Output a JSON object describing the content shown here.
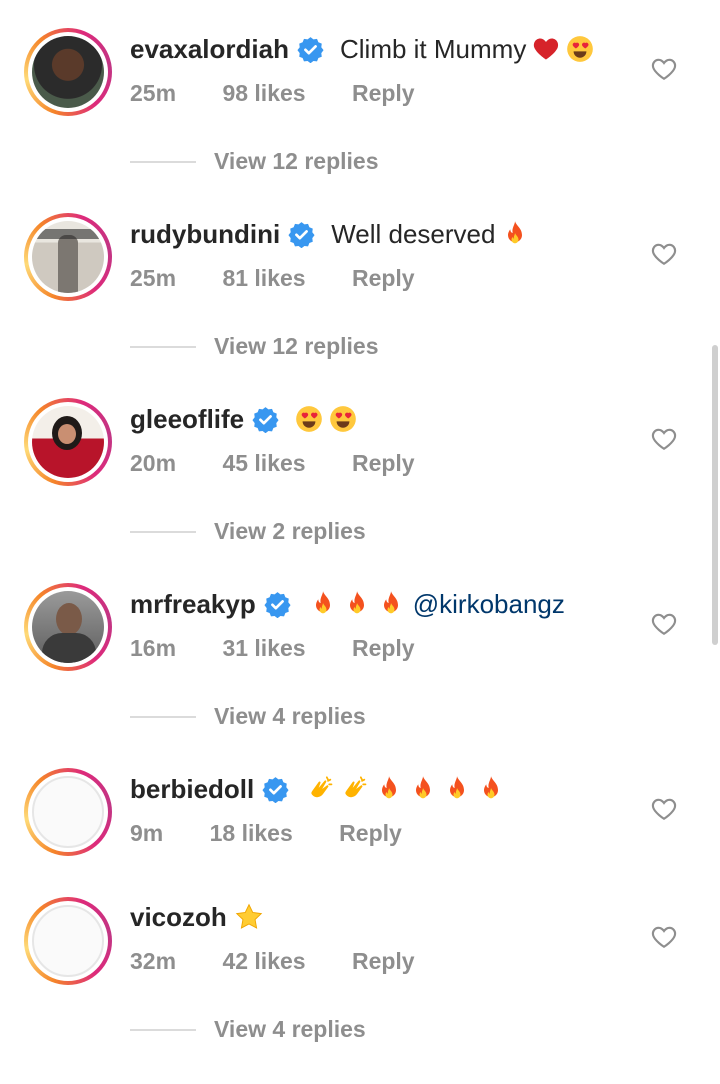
{
  "comments": [
    {
      "username": "evaxalordiah",
      "verified": true,
      "text": "Climb it Mummy",
      "emojis": [
        "red-heart",
        "heart-eyes"
      ],
      "mention": "",
      "time": "25m",
      "likes": "98 likes",
      "reply": "Reply",
      "view_replies": "View 12 replies",
      "avatar": "photo-dark"
    },
    {
      "username": "rudybundini",
      "verified": true,
      "text": "Well deserved",
      "emojis": [
        "fire"
      ],
      "mention": "",
      "time": "25m",
      "likes": "81 likes",
      "reply": "Reply",
      "view_replies": "View 12 replies",
      "avatar": "photo-magazine"
    },
    {
      "username": "gleeoflife",
      "verified": true,
      "text": "",
      "emojis": [
        "heart-eyes",
        "heart-eyes"
      ],
      "mention": "",
      "time": "20m",
      "likes": "45 likes",
      "reply": "Reply",
      "view_replies": "View 2 replies",
      "avatar": "photo-red"
    },
    {
      "username": "mrfreakyp",
      "verified": true,
      "text": "",
      "emojis": [
        "fire",
        "fire",
        "fire"
      ],
      "mention": "@kirkobangz",
      "time": "16m",
      "likes": "31 likes",
      "reply": "Reply",
      "view_replies": "View 4 replies",
      "avatar": "photo-gray"
    },
    {
      "username": "berbiedoll",
      "verified": true,
      "text": "",
      "emojis": [
        "clap",
        "clap",
        "fire",
        "fire",
        "fire",
        "fire"
      ],
      "mention": "",
      "time": "9m",
      "likes": "18 likes",
      "reply": "Reply",
      "view_replies": "",
      "avatar": "empty"
    },
    {
      "username": "vicozoh",
      "verified": false,
      "text": "",
      "emojis": [
        "star"
      ],
      "mention": "",
      "time": "32m",
      "likes": "42 likes",
      "reply": "Reply",
      "view_replies": "View 4 replies",
      "avatar": "empty"
    }
  ],
  "icons": {
    "like": "heart-outline-icon",
    "verified": "verified-badge-icon"
  },
  "colors": {
    "verified": "#3897f0",
    "mention": "#00376b",
    "muted": "#8e8e8e",
    "text": "#262626"
  }
}
